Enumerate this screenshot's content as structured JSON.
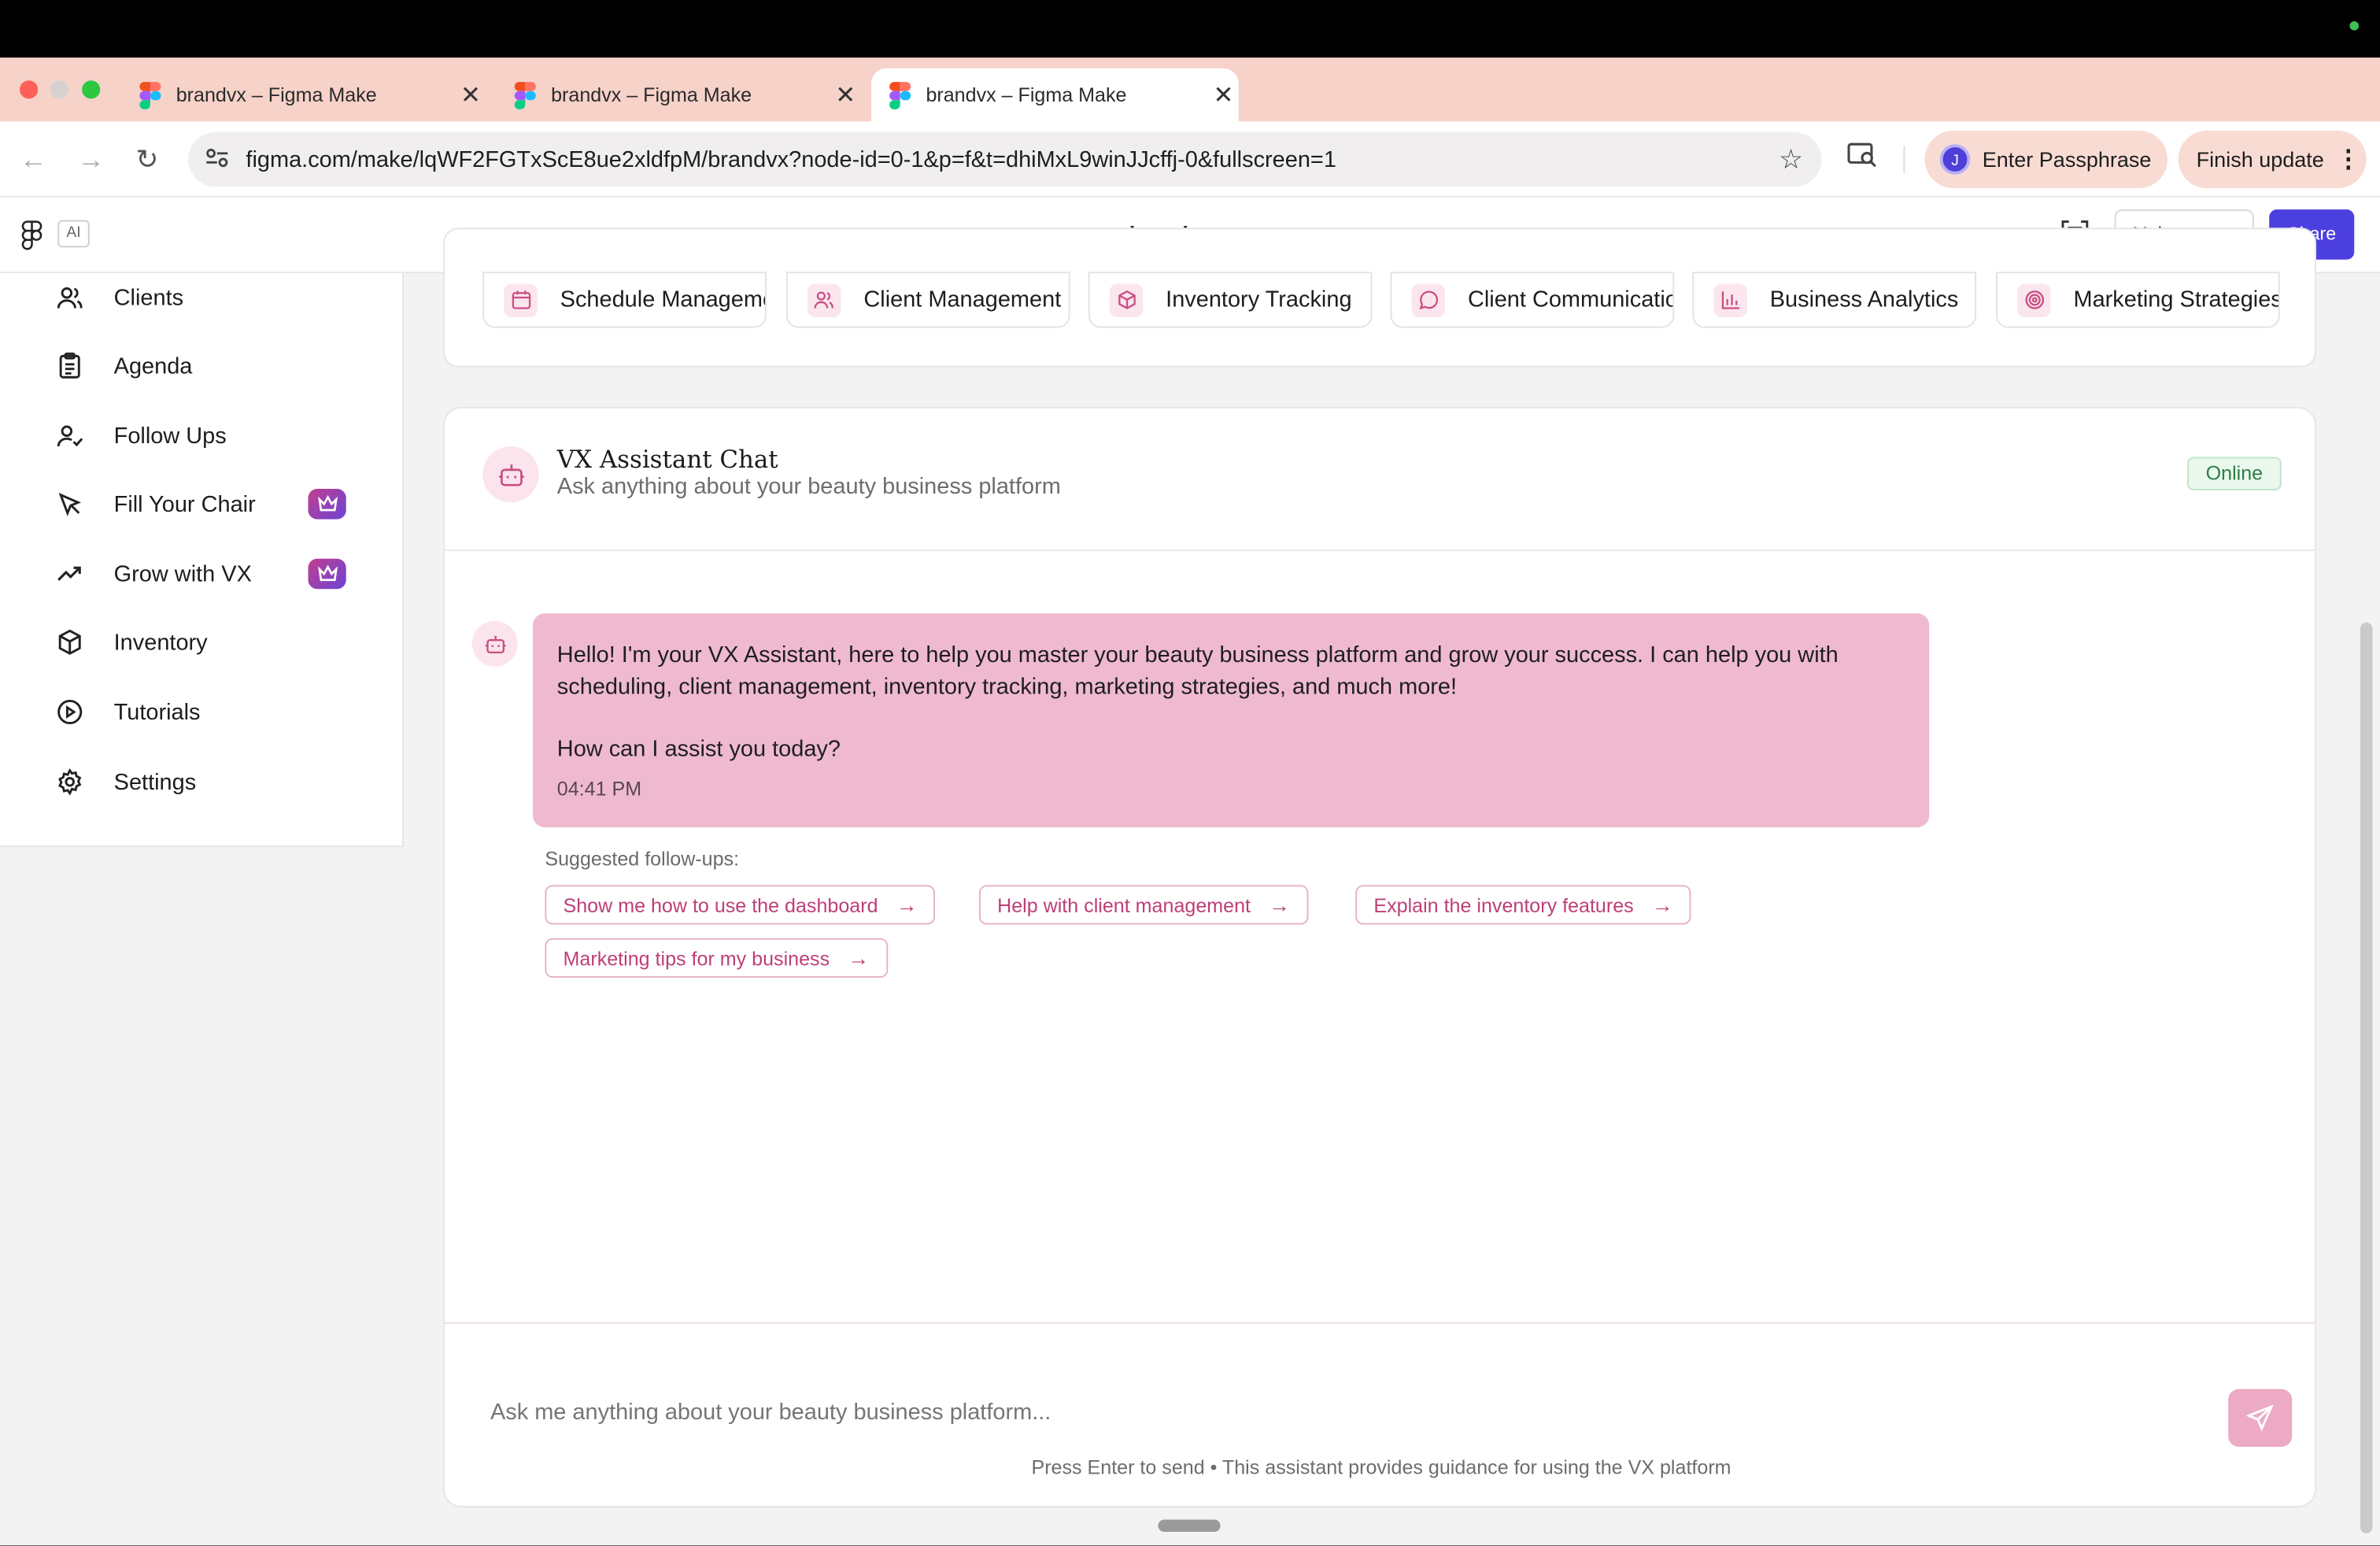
{
  "browser": {
    "tabs": [
      {
        "title": "brandvx – Figma Make",
        "close": "✕"
      },
      {
        "title": "brandvx – Figma Make",
        "close": "✕"
      },
      {
        "title": "brandvx – Figma Make",
        "close": "✕"
      }
    ],
    "new_tab": "+",
    "url": "figma.com/make/lqWF2FGTxScE8ue2xldfpM/brandvx?node-id=0-1&p=f&t=dhiMxL9winJJcffj-0&fullscreen=1",
    "passphrase_label": "Enter Passphrase",
    "avatar_letter": "J",
    "finish_update_label": "Finish update"
  },
  "figma": {
    "ai_badge": "AI",
    "project_name": "brandvx",
    "make_copy_label": "Make a copy",
    "share_label": "Share"
  },
  "sidebar": {
    "items": [
      {
        "label": "Clients",
        "icon": "users-icon",
        "premium": false
      },
      {
        "label": "Agenda",
        "icon": "clipboard-icon",
        "premium": false
      },
      {
        "label": "Follow Ups",
        "icon": "user-check-icon",
        "premium": false
      },
      {
        "label": "Fill Your Chair",
        "icon": "pointer-icon",
        "premium": true
      },
      {
        "label": "Grow with VX",
        "icon": "trending-up-icon",
        "premium": true
      },
      {
        "label": "Inventory",
        "icon": "box-icon",
        "premium": false
      },
      {
        "label": "Tutorials",
        "icon": "play-circle-icon",
        "premium": false
      },
      {
        "label": "Settings",
        "icon": "gear-icon",
        "premium": false
      }
    ]
  },
  "categories": [
    {
      "label": "Schedule Management",
      "icon": "calendar-icon"
    },
    {
      "label": "Client Management",
      "icon": "users-icon"
    },
    {
      "label": "Inventory Tracking",
      "icon": "box-icon"
    },
    {
      "label": "Client Communication",
      "icon": "message-icon"
    },
    {
      "label": "Business Analytics",
      "icon": "bar-chart-icon"
    },
    {
      "label": "Marketing Strategies",
      "icon": "target-icon"
    }
  ],
  "chat": {
    "title": "VX Assistant Chat",
    "subtitle": "Ask anything about your beauty business platform",
    "status": "Online",
    "message": {
      "text1": "Hello! I'm your VX Assistant, here to help you master your beauty business platform and grow your success. I can help you with scheduling, client management, inventory tracking, marketing strategies, and much more!",
      "text2": "How can I assist you today?",
      "time": "04:41 PM"
    },
    "suggestions_label": "Suggested follow-ups:",
    "suggestions": [
      "Show me how to use the dashboard",
      "Help with client management",
      "Explain the inventory features",
      "Marketing tips for my business"
    ],
    "input_placeholder": "Ask me anything about your beauty business platform...",
    "hint": "Press Enter to send • This assistant provides guidance for using the VX platform"
  },
  "colors": {
    "accent_pink": "#efbad0",
    "accent_text": "#bd3f77",
    "share_blue": "#4c3fe0",
    "online_green": "#2f7d44"
  }
}
